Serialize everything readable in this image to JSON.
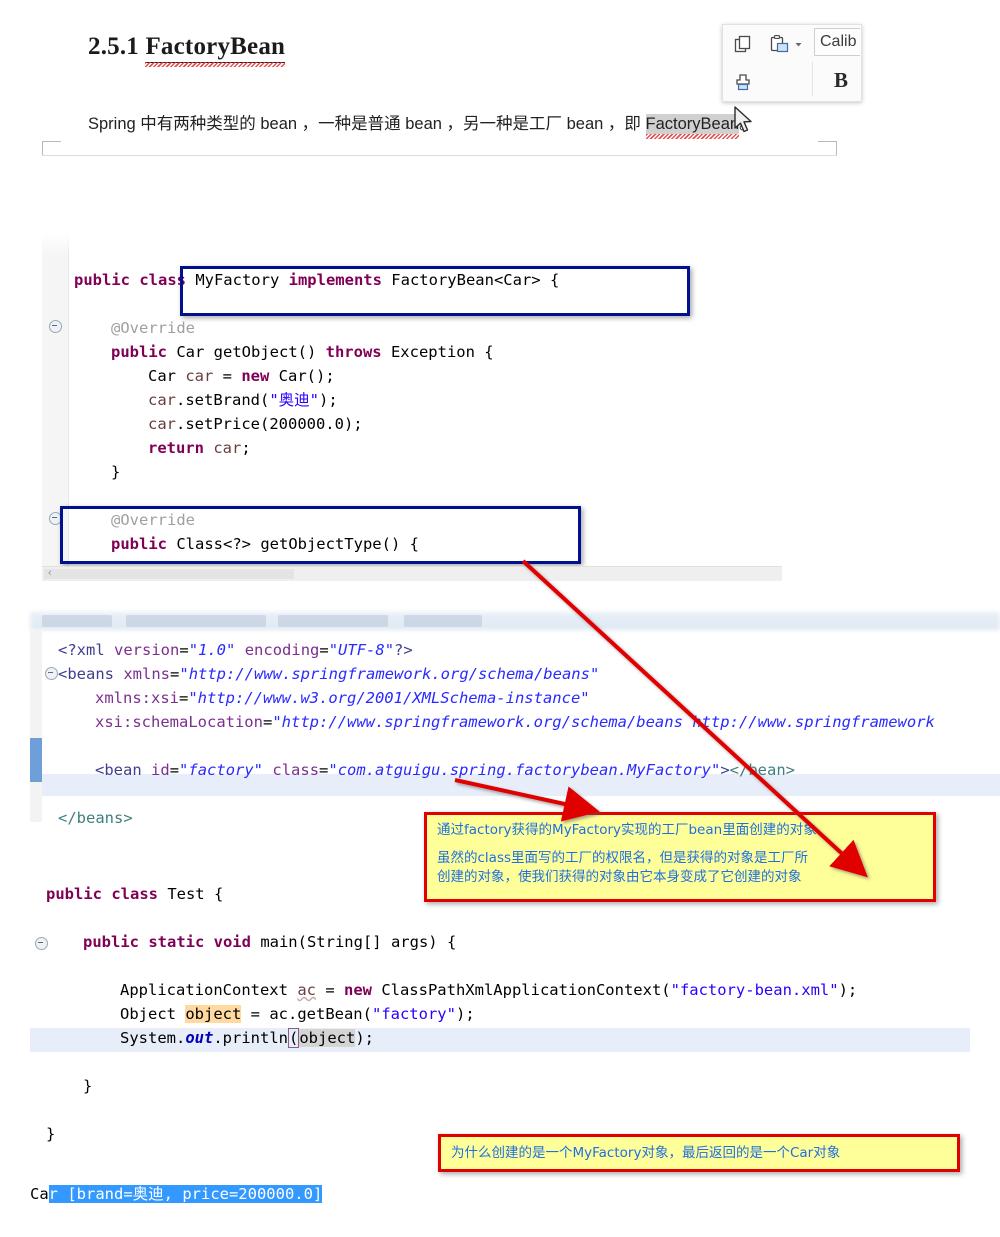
{
  "word_document": {
    "heading_number": "2.5.1",
    "heading_title": "FactoryBean",
    "paragraph_part1": "Spring 中有两种类型的 bean ，一种是普通 bean ，另一种是工厂 bean ，即 ",
    "paragraph_highlight": "FactoryBean",
    "paragraph_part2": "。"
  },
  "mini_toolbar": {
    "copy_icon": "copy-icon",
    "paste_icon": "paste-icon",
    "paste_dropdown_icon": "chevron-down-icon",
    "cut_icon": "scissors-icon",
    "format_painter_icon": "format-painter-icon",
    "font_name": "Calib",
    "bold_label": "B"
  },
  "cursor": {
    "icon": "mouse-pointer-icon"
  },
  "java_editor": {
    "lines": [
      {
        "indent": 0,
        "html": "<span class=\"kw\">public class</span> MyFactory <span class=\"kw\">implements</span> FactoryBean&lt;Car&gt; {"
      },
      {
        "indent": 0,
        "html": ""
      },
      {
        "indent": 1,
        "html": "<span class=\"ann\">@Override</span>"
      },
      {
        "indent": 1,
        "html": "<span class=\"kw\">public</span> Car getObject() <span class=\"kw\">throws</span> Exception {"
      },
      {
        "indent": 2,
        "html": "Car <span class=\"loc\">car</span> = <span class=\"kw\">new</span> Car();"
      },
      {
        "indent": 2,
        "html": "<span class=\"loc\">car</span>.setBrand(<span class=\"str\">\"奥迪\"</span>);"
      },
      {
        "indent": 2,
        "html": "<span class=\"loc\">car</span>.setPrice(200000.0);"
      },
      {
        "indent": 2,
        "html": "<span class=\"kw\">return</span> <span class=\"loc\">car</span>;"
      },
      {
        "indent": 1,
        "html": "}"
      },
      {
        "indent": 0,
        "html": ""
      },
      {
        "indent": 1,
        "html": "<span class=\"ann\">@Override</span>"
      },
      {
        "indent": 1,
        "html": "<span class=\"kw\">public</span> Class&lt;?&gt; getObjectType() {"
      }
    ],
    "highlight_boxes": [
      {
        "name": "class-declaration-box"
      },
      {
        "name": "getobjecttype-box"
      }
    ],
    "scrollbar": {
      "left_arrow": "‹"
    }
  },
  "xml_editor": {
    "lines": [
      {
        "indent": 0,
        "html": "<span class=\"xtag\">&lt;?xml</span> <span class=\"xattr\">version</span>=<span class=\"xval\">\"1.0\"</span> <span class=\"xattr\">encoding</span>=<span class=\"xval\">\"UTF-8\"</span><span class=\"xtag\">?&gt;</span>"
      },
      {
        "indent": 0,
        "html": "<span class=\"xtag\">&lt;beans</span> <span class=\"xattr\">xmlns</span>=<span class=\"xval\">\"http://www.springframework.org/schema/beans\"</span>"
      },
      {
        "indent": 1,
        "html": "<span class=\"xattr\">xmlns:xsi</span>=<span class=\"xval\">\"http://www.w3.org/2001/XMLSchema-instance\"</span>"
      },
      {
        "indent": 1,
        "html": "<span class=\"xattr\">xsi:schemaLocation</span>=<span class=\"xval\">\"http://www.springframework.org/schema/beans http://www.springframework</span>"
      },
      {
        "indent": 0,
        "html": ""
      },
      {
        "indent": 1,
        "html": "<span class=\"xtag\">&lt;bean</span> <span class=\"xattr\">id</span>=<span class=\"xval\">\"factory\"</span> <span class=\"xattr\">class</span>=<span class=\"xval\">\"com.atguigu.spring.factorybean.MyFactory\"</span><span class=\"xtag\">&gt;</span><span class=\"xclose\">&lt;/bean&gt;</span>"
      },
      {
        "indent": 0,
        "html": ""
      },
      {
        "indent": 0,
        "html": "<span class=\"xclose\">&lt;/beans&gt;</span>"
      }
    ]
  },
  "test_editor": {
    "lines": [
      {
        "indent": 0,
        "html": "<span class=\"kw\">public class</span> Test {"
      },
      {
        "indent": 0,
        "html": ""
      },
      {
        "indent": 1,
        "html": "<span class=\"kw\">public static void</span> main(String[] args) {"
      },
      {
        "indent": 0,
        "html": ""
      },
      {
        "indent": 2,
        "html": "ApplicationContext <span class=\"loc\" style=\"text-decoration:underline;text-decoration-style:wavy;text-decoration-color:#caa\">ac</span> = <span class=\"kw\">new</span> ClassPathXmlApplicationContext(<span class=\"str\">\"factory-bean.xml\"</span>);"
      },
      {
        "indent": 2,
        "html": "Object <span class=\"hl-orange\">object</span> = ac.getBean(<span class=\"str\">\"factory\"</span>);"
      },
      {
        "indent": 2,
        "html": "System.<span class=\"sfld\">out</span>.println<span class=\"brkt\">(</span><span class=\"hl-gray\">object</span>);"
      },
      {
        "indent": 0,
        "html": ""
      },
      {
        "indent": 1,
        "html": "}"
      },
      {
        "indent": 0,
        "html": ""
      },
      {
        "indent": 0,
        "html": "}"
      }
    ]
  },
  "console": {
    "prefix": "Ca",
    "selected_text": "r [brand=奥迪, price=200000.0]"
  },
  "callouts": [
    {
      "id": "callout-1",
      "line1": "通过factory获得的MyFactory实现的工厂bean里面创建的对象",
      "line2": "虽然的class里面写的工厂的权限名，但是获得的对象是工厂所",
      "line3": "创建的对象，使我们获得的对象由它本身变成了它创建的对象"
    },
    {
      "id": "callout-2",
      "line1": "为什么创建的是一个MyFactory对象，最后返回的是一个Car对象"
    }
  ],
  "colors": {
    "callout_bg": "#ffff99",
    "callout_border": "#e00000",
    "callout_text": "#1f6fe0",
    "arrow_red": "#e00000",
    "blue_box": "#00108f",
    "keyword": "#7f0055",
    "string": "#2a00ff",
    "selection_blue": "#3399ff"
  }
}
